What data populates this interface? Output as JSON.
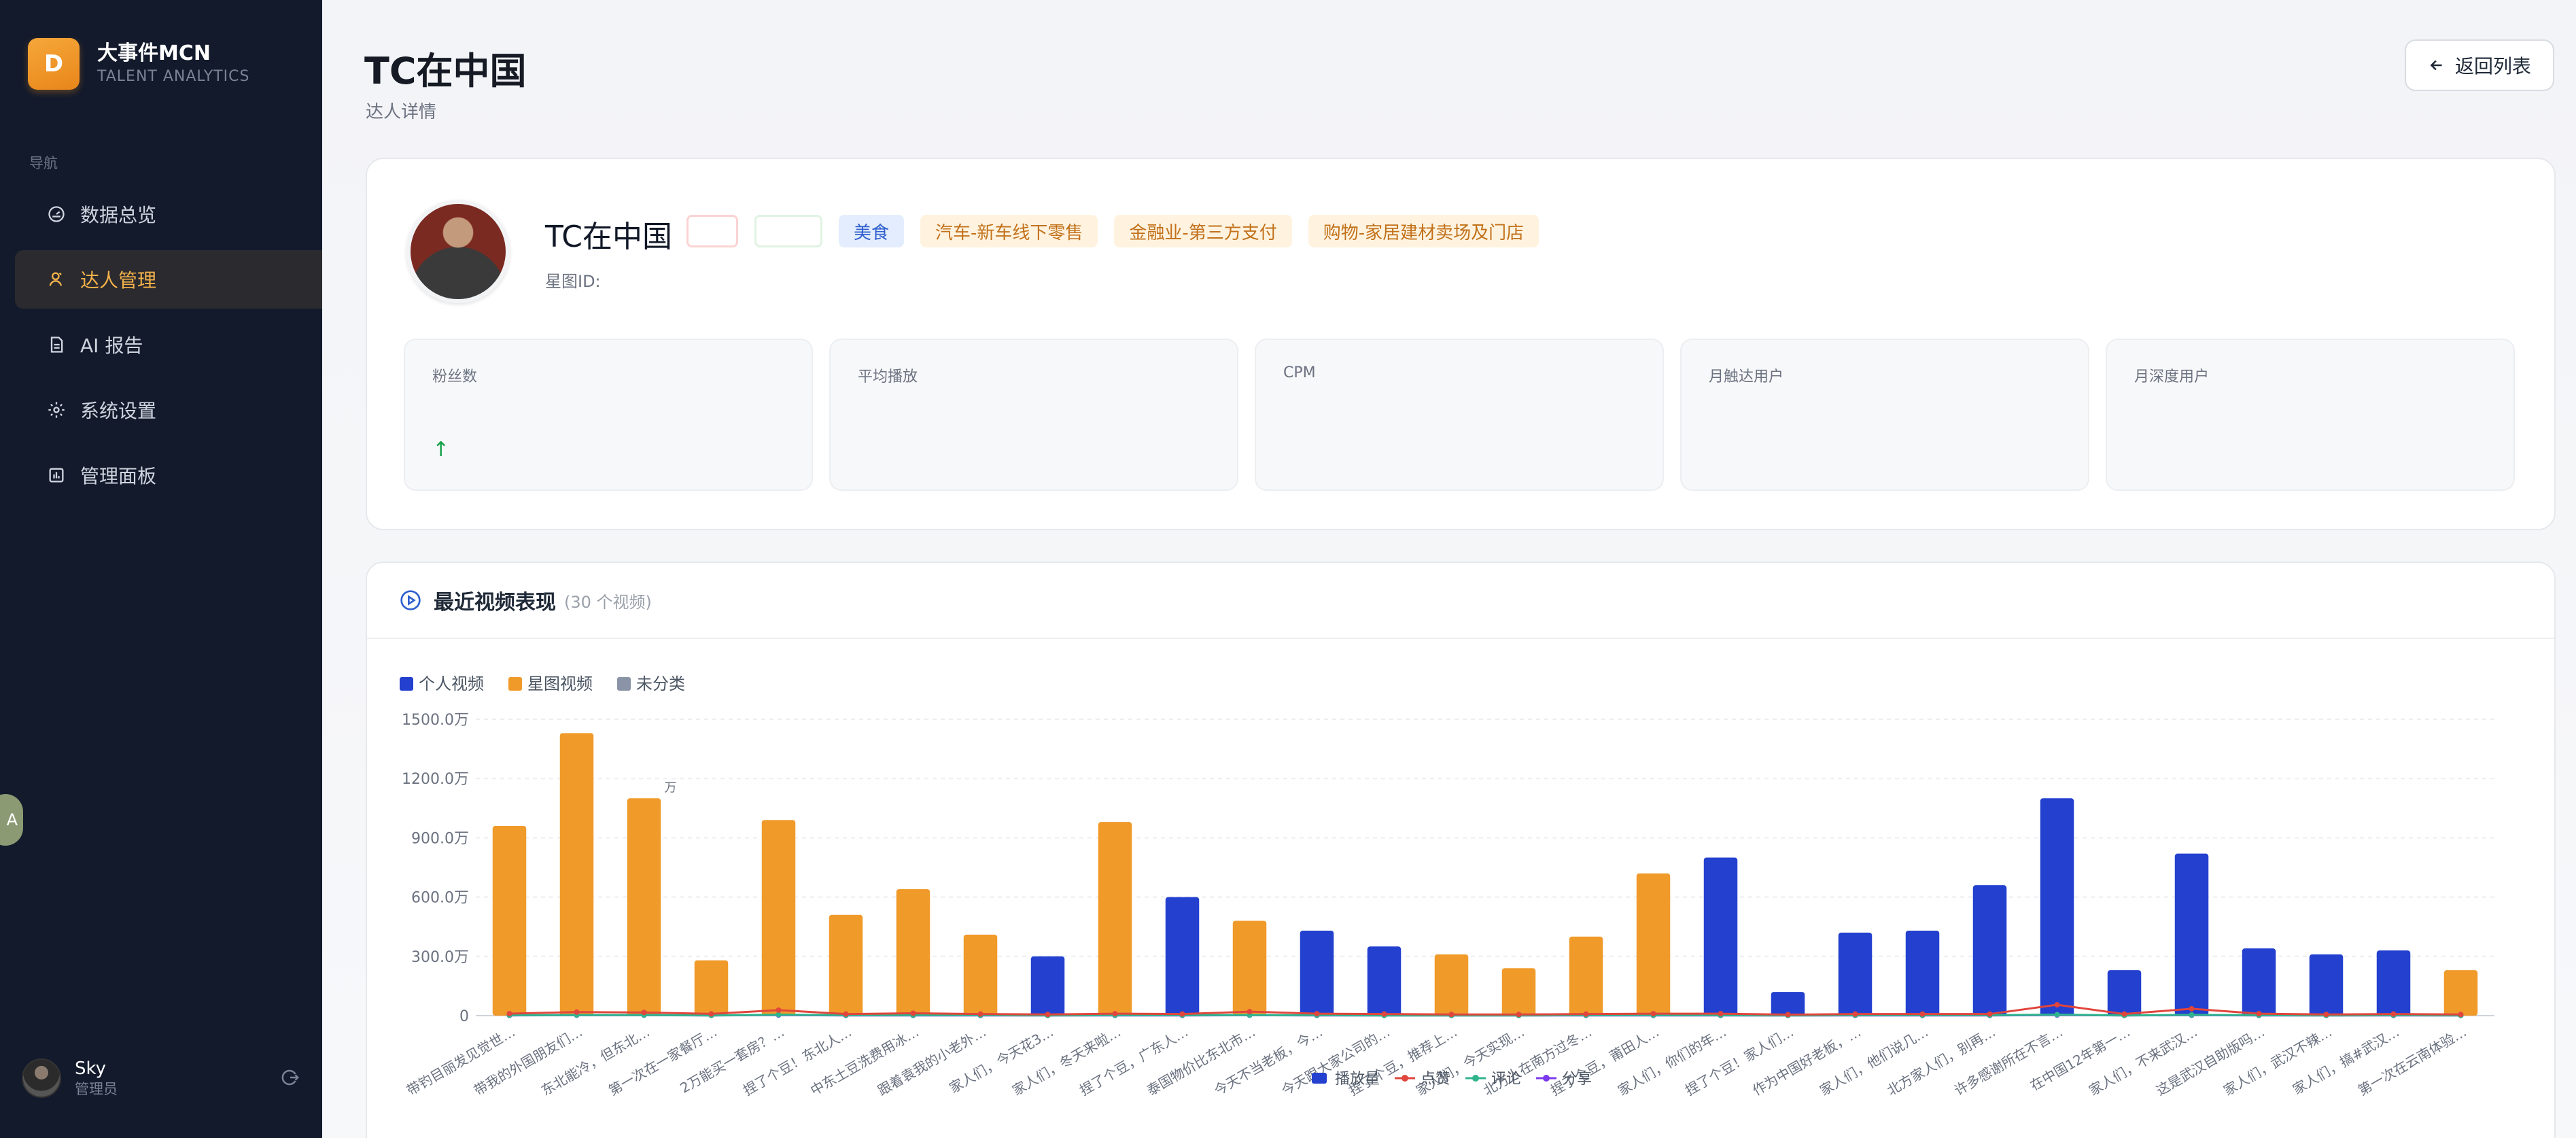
{
  "brand": {
    "logo_letter": "D",
    "name": "大事件MCN",
    "subtitle": "TALENT ANALYTICS"
  },
  "nav": {
    "section_label": "导航",
    "items": [
      {
        "label": "数据总览",
        "icon": "dashboard-gauge-icon",
        "active": false
      },
      {
        "label": "达人管理",
        "icon": "user-icon",
        "active": true
      },
      {
        "label": "AI 报告",
        "icon": "document-icon",
        "active": false
      },
      {
        "label": "系统设置",
        "icon": "gear-icon",
        "active": false
      },
      {
        "label": "管理面板",
        "icon": "bar-chart-icon",
        "active": false
      }
    ]
  },
  "side_float_label": "A",
  "user": {
    "name": "Sky",
    "role": "管理员"
  },
  "header": {
    "title": "TC在中国",
    "subtitle": "达人详情",
    "back_label": "返回列表"
  },
  "profile": {
    "name": "TC在中国",
    "tags": [
      "美食",
      "汽车-新车线下零售",
      "金融业-第三方支付",
      "购物-家居建材卖场及门店"
    ],
    "star_id_label": "星图ID:",
    "metrics": [
      {
        "label": "粉丝数",
        "trend": "↑"
      },
      {
        "label": "平均播放",
        "trend": ""
      },
      {
        "label": "CPM",
        "trend": ""
      },
      {
        "label": "月触达用户",
        "trend": ""
      },
      {
        "label": "月深度用户",
        "trend": ""
      }
    ]
  },
  "videos": {
    "title": "最近视频表现",
    "count_label": "(30 个视频)"
  },
  "colors": {
    "personal": "#2340cf",
    "star": "#f09a2a",
    "uncategorized": "#8a94a6",
    "likes": "#e0463c",
    "comments": "#2fb58c",
    "shares": "#7c3aed",
    "accent": "#f4b24a"
  },
  "chart_data": {
    "type": "bar",
    "category_legend": [
      "个人视频",
      "星图视频",
      "未分类"
    ],
    "series_legend": [
      "播放量",
      "点赞",
      "评论",
      "分享"
    ],
    "y_ticks": [
      "0",
      "300.0万",
      "600.0万",
      "900.0万",
      "1200.0万",
      "1500.0万"
    ],
    "ylim": [
      0,
      1500
    ],
    "y_unit": "万",
    "stray_label": "万",
    "categories": [
      "带钓目丽发见觉世…",
      "带我的外国朋友们…",
      "东北能冷，但东北…",
      "第一次在一家餐厅…",
      "2万能买一套房？…",
      "捏了个豆！东北人…",
      "中东土豆洗费用冰…",
      "跟着袁我的小老外…",
      "家人们，今天花3…",
      "家人们，冬天来啦…",
      "捏了个豆，广东人…",
      "泰国物价比东北市…",
      "今天不当老板，今…",
      "今天跟大家公司的…",
      "捏了个豆，推荐上…",
      "家人们，今天实现…",
      "北方人在南方过冬…",
      "捏了个豆，莆田人…",
      "家人们，你们的年…",
      "捏了个豆！家人们…",
      "作为中国好老板，…",
      "家人们，他们说几…",
      "北方家人们，别再…",
      "许多感谢所在不言…",
      "在中国12年第一…",
      "家人们，不来武汉…",
      "这是武汉自助版吗…",
      "家人们，武汉不辣…",
      "家人们，搞#武汉…",
      "第一次在云南体验…"
    ],
    "types": [
      "star",
      "star",
      "star",
      "star",
      "star",
      "star",
      "star",
      "star",
      "personal",
      "star",
      "personal",
      "star",
      "personal",
      "personal",
      "star",
      "star",
      "star",
      "star",
      "personal",
      "personal",
      "personal",
      "personal",
      "personal",
      "personal",
      "personal",
      "personal",
      "personal",
      "personal",
      "personal",
      "star"
    ],
    "plays": [
      960,
      1430,
      1100,
      280,
      990,
      510,
      640,
      410,
      300,
      980,
      600,
      480,
      430,
      350,
      310,
      240,
      400,
      720,
      800,
      120,
      420,
      430,
      660,
      1100,
      230,
      820,
      340,
      310,
      330,
      230
    ],
    "likes": [
      10,
      18,
      16,
      9,
      28,
      8,
      12,
      8,
      6,
      10,
      8,
      20,
      10,
      8,
      6,
      6,
      8,
      10,
      10,
      5,
      8,
      8,
      8,
      55,
      8,
      35,
      10,
      6,
      8,
      6
    ],
    "comments": [
      2,
      3,
      3,
      1,
      5,
      2,
      2,
      2,
      1,
      2,
      2,
      3,
      2,
      1,
      1,
      1,
      2,
      2,
      2,
      1,
      2,
      2,
      2,
      5,
      1,
      4,
      2,
      1,
      2,
      1
    ],
    "shares": [
      1,
      2,
      2,
      1,
      3,
      1,
      1,
      1,
      1,
      1,
      1,
      2,
      1,
      1,
      1,
      1,
      1,
      1,
      1,
      1,
      1,
      1,
      1,
      3,
      1,
      2,
      1,
      1,
      1,
      1
    ]
  }
}
